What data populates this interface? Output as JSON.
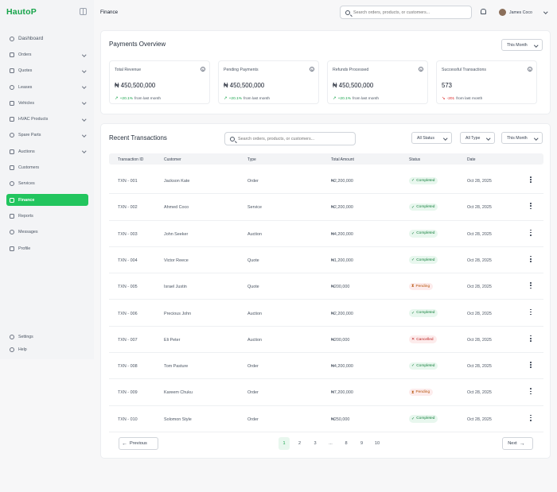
{
  "app": {
    "logo": "HautoP"
  },
  "sidebar": {
    "items": [
      {
        "label": "Dashboard",
        "icon": "dashboard-icon",
        "has_chevron": false
      },
      {
        "label": "Orders",
        "icon": "cart-icon",
        "has_chevron": true
      },
      {
        "label": "Quotes",
        "icon": "document-icon",
        "has_chevron": true
      },
      {
        "label": "Leases",
        "icon": "key-icon",
        "has_chevron": true
      },
      {
        "label": "Vehicles",
        "icon": "car-icon",
        "has_chevron": true
      },
      {
        "label": "HVAC Products",
        "icon": "fan-icon",
        "has_chevron": true
      },
      {
        "label": "Spare Parts",
        "icon": "gear-icon",
        "has_chevron": true
      },
      {
        "label": "Auctions",
        "icon": "gavel-icon",
        "has_chevron": true
      },
      {
        "label": "Customers",
        "icon": "users-icon",
        "has_chevron": false
      },
      {
        "label": "Services",
        "icon": "wrench-icon",
        "has_chevron": false
      },
      {
        "label": "Finance",
        "icon": "wallet-icon",
        "has_chevron": false,
        "active": true
      },
      {
        "label": "Reports",
        "icon": "report-icon",
        "has_chevron": false
      },
      {
        "label": "Messages",
        "icon": "message-icon",
        "has_chevron": false
      },
      {
        "label": "Profile",
        "icon": "user-icon",
        "has_chevron": false
      }
    ],
    "bottom": [
      {
        "label": "Settings",
        "icon": "settings-icon"
      },
      {
        "label": "Help",
        "icon": "help-icon"
      }
    ]
  },
  "header": {
    "title": "Finance",
    "search_placeholder": "Search orders, products, or customers...",
    "user_name": "James Coco"
  },
  "overview": {
    "title": "Payments Overview",
    "period": "This Month",
    "stats": [
      {
        "label": "Total Revenue",
        "value": "₦ 450,500,000",
        "change": "+20.1%",
        "trend": "up",
        "suffix": "from last month"
      },
      {
        "label": "Pending Payments",
        "value": "₦ 450,500,000",
        "change": "+20.1%",
        "trend": "up",
        "suffix": "from last month"
      },
      {
        "label": "Refunds Processed",
        "value": "₦ 450,500,000",
        "change": "+20.1%",
        "trend": "up",
        "suffix": "from last month"
      },
      {
        "label": "Successful Transactions",
        "value": "573",
        "change": "-201",
        "trend": "down",
        "suffix": "from last month"
      }
    ]
  },
  "transactions": {
    "title": "Recent Transactions",
    "search_placeholder": "Search orders, products, or customers...",
    "filters": {
      "status": "All Status",
      "type": "All Type",
      "period": "This Month"
    },
    "columns": [
      "Transaction ID",
      "Customer",
      "Type",
      "Total Amount",
      "Status",
      "Date"
    ],
    "rows": [
      {
        "id": "TXN - 001",
        "customer": "Jackson Kate",
        "type": "Order",
        "amount": "₦2,200,000",
        "status": "Completed",
        "date": "Oct 28, 2025"
      },
      {
        "id": "TXN - 002",
        "customer": "Ahmed Coco",
        "type": "Service",
        "amount": "₦2,200,000",
        "status": "Completed",
        "date": "Oct 28, 2025"
      },
      {
        "id": "TXN - 003",
        "customer": "John Seeker",
        "type": "Auction",
        "amount": "₦4,200,000",
        "status": "Completed",
        "date": "Oct 28, 2025"
      },
      {
        "id": "TXN - 004",
        "customer": "Victor Reece",
        "type": "Quote",
        "amount": "₦1,200,000",
        "status": "Completed",
        "date": "Oct 28, 2025"
      },
      {
        "id": "TXN - 005",
        "customer": "Israel Justin",
        "type": "Quote",
        "amount": "₦200,000",
        "status": "Pending",
        "date": "Oct 28, 2025"
      },
      {
        "id": "TXN - 006",
        "customer": "Precious John",
        "type": "Auction",
        "amount": "₦2,200,000",
        "status": "Completed",
        "date": "Oct 28, 2025"
      },
      {
        "id": "TXN - 007",
        "customer": "Eli Peter",
        "type": "Auction",
        "amount": "₦200,000",
        "status": "Cancelled",
        "date": "Oct 28, 2025"
      },
      {
        "id": "TXN - 008",
        "customer": "Tom Pasture",
        "type": "Order",
        "amount": "₦4,200,000",
        "status": "Completed",
        "date": "Oct 28, 2025"
      },
      {
        "id": "TXN - 009",
        "customer": "Kareem Chuku",
        "type": "Order",
        "amount": "₦7,200,000",
        "status": "Pending",
        "date": "Oct 28, 2025"
      },
      {
        "id": "TXN - 010",
        "customer": "Solomon Style",
        "type": "Order",
        "amount": "₦250,000",
        "status": "Completed",
        "date": "Oct 28, 2025"
      }
    ]
  },
  "pagination": {
    "prev_label": "Previous",
    "next_label": "Next",
    "pages": [
      "1",
      "2",
      "3",
      "...",
      "8",
      "9",
      "10"
    ],
    "current": "1"
  },
  "colors": {
    "accent": "#22c55e",
    "success": "#16a34a",
    "danger": "#dc2626"
  }
}
